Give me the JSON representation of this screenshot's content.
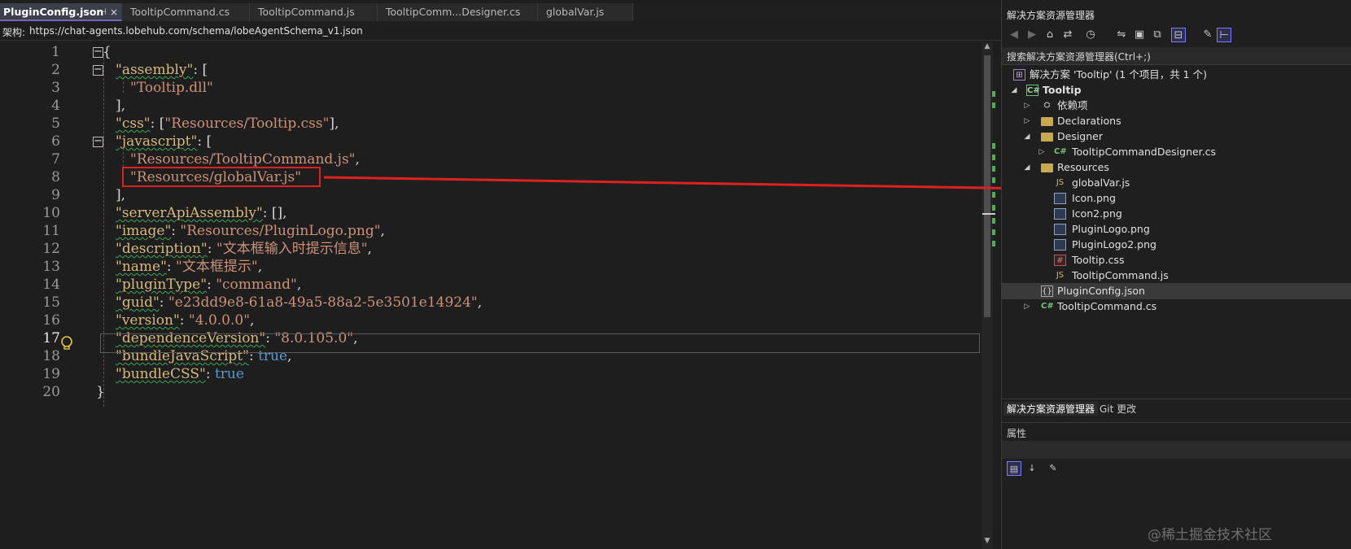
{
  "tabs": [
    {
      "label": "PluginConfig.json",
      "active": true
    },
    {
      "label": "TooltipCommand.cs"
    },
    {
      "label": "TooltipCommand.js"
    },
    {
      "label": "TooltipComm...Designer.cs"
    },
    {
      "label": "globalVar.js"
    }
  ],
  "tab_icons": {
    "pin": "⊣",
    "close": "×",
    "dropdown": "▼",
    "gear": "⚙"
  },
  "schema": {
    "label": "架构:",
    "url": "https://chat-agents.lobehub.com/schema/lobeAgentSchema_v1.json"
  },
  "code": {
    "line_numbers": [
      "1",
      "2",
      "3",
      "4",
      "5",
      "6",
      "7",
      "8",
      "9",
      "10",
      "11",
      "12",
      "13",
      "14",
      "15",
      "16",
      "17",
      "18",
      "19",
      "20"
    ],
    "current_line": "17"
  },
  "json_tokens": {
    "open": "{",
    "close": "}",
    "assembly_key": "\"assembly\"",
    "assembly_val": "\"Tooltip.dll\"",
    "css_key": "\"css\"",
    "css_val": "\"Resources/Tooltip.css\"",
    "javascript_key": "\"javascript\"",
    "js_val1": "\"Resources/TooltipCommand.js\"",
    "js_val2": "\"Resources/globalVar.js\"",
    "serverApiAssembly_key": "\"serverApiAssembly\"",
    "image_key": "\"image\"",
    "image_val": "\"Resources/PluginLogo.png\"",
    "description_key": "\"description\"",
    "description_val": "\"文本框输入时提示信息\"",
    "name_key": "\"name\"",
    "name_val": "\"文本框提示\"",
    "pluginType_key": "\"pluginType\"",
    "pluginType_val": "\"command\"",
    "guid_key": "\"guid\"",
    "guid_val": "\"e23dd9e8-61a8-49a5-88a2-5e3501e14924\"",
    "version_key": "\"version\"",
    "version_val": "\"4.0.0.0\"",
    "dependenceVersion_key": "\"dependenceVersion\"",
    "dependenceVersion_val": "\"8.0.105.0\"",
    "bundleJavaScript_key": "\"bundleJavaScript\"",
    "bundleCSS_key": "\"bundleCSS\"",
    "true_val": "true"
  },
  "explorer": {
    "title": "解决方案资源管理器",
    "search_placeholder": "搜索解决方案资源管理器(Ctrl+;)",
    "tree": [
      {
        "label": "解决方案 'Tooltip' (1 个项目，共 1 个)",
        "icon": "solution-icon",
        "icon_text": "⊞"
      },
      {
        "label": "Tooltip",
        "icon": "csharp-project-icon",
        "icon_text": "C#",
        "bold": true,
        "arrow": "◢"
      },
      {
        "label": "依赖项",
        "icon": "dependencies-icon",
        "icon_text": "⛭",
        "arrow": "▷"
      },
      {
        "label": "Declarations",
        "icon": "folder-icon",
        "arrow": "▷"
      },
      {
        "label": "Designer",
        "icon": "folder-icon",
        "arrow": "◢"
      },
      {
        "label": "TooltipCommandDesigner.cs",
        "icon": "csharp-file-icon",
        "icon_text": "C#",
        "arrow": "▷"
      },
      {
        "label": "Resources",
        "icon": "folder-icon",
        "arrow": "◢"
      },
      {
        "label": "globalVar.js",
        "icon": "js-file-icon",
        "icon_text": "JS"
      },
      {
        "label": "Icon.png",
        "icon": "image-file-icon"
      },
      {
        "label": "Icon2.png",
        "icon": "image-file-icon"
      },
      {
        "label": "PluginLogo.png",
        "icon": "image-file-icon"
      },
      {
        "label": "PluginLogo2.png",
        "icon": "image-file-icon"
      },
      {
        "label": "Tooltip.css",
        "icon": "css-file-icon",
        "icon_text": "#"
      },
      {
        "label": "TooltipCommand.js",
        "icon": "js-file-icon",
        "icon_text": "JS"
      },
      {
        "label": "PluginConfig.json",
        "icon": "json-file-icon",
        "icon_text": "{}",
        "selected": true
      },
      {
        "label": "TooltipCommand.cs",
        "icon": "csharp-file-icon",
        "icon_text": "C#",
        "arrow": "▷"
      }
    ],
    "bottom_tabs": [
      "解决方案资源管理器",
      "Git 更改"
    ],
    "properties_title": "属性",
    "toolbar_icons": [
      "back-icon",
      "forward-icon",
      "home-icon",
      "switch-views-icon",
      "history-icon",
      "sync-icon",
      "collapse-all-icon",
      "show-all-files-icon",
      "preview-icon",
      "properties-icon",
      "pin-icon"
    ]
  },
  "watermark": "@稀土掘金技术社区",
  "colors": {
    "accent_tab": "#7a5fc5",
    "annotation_red": "#e02020",
    "squiggle": "#3aa655"
  }
}
